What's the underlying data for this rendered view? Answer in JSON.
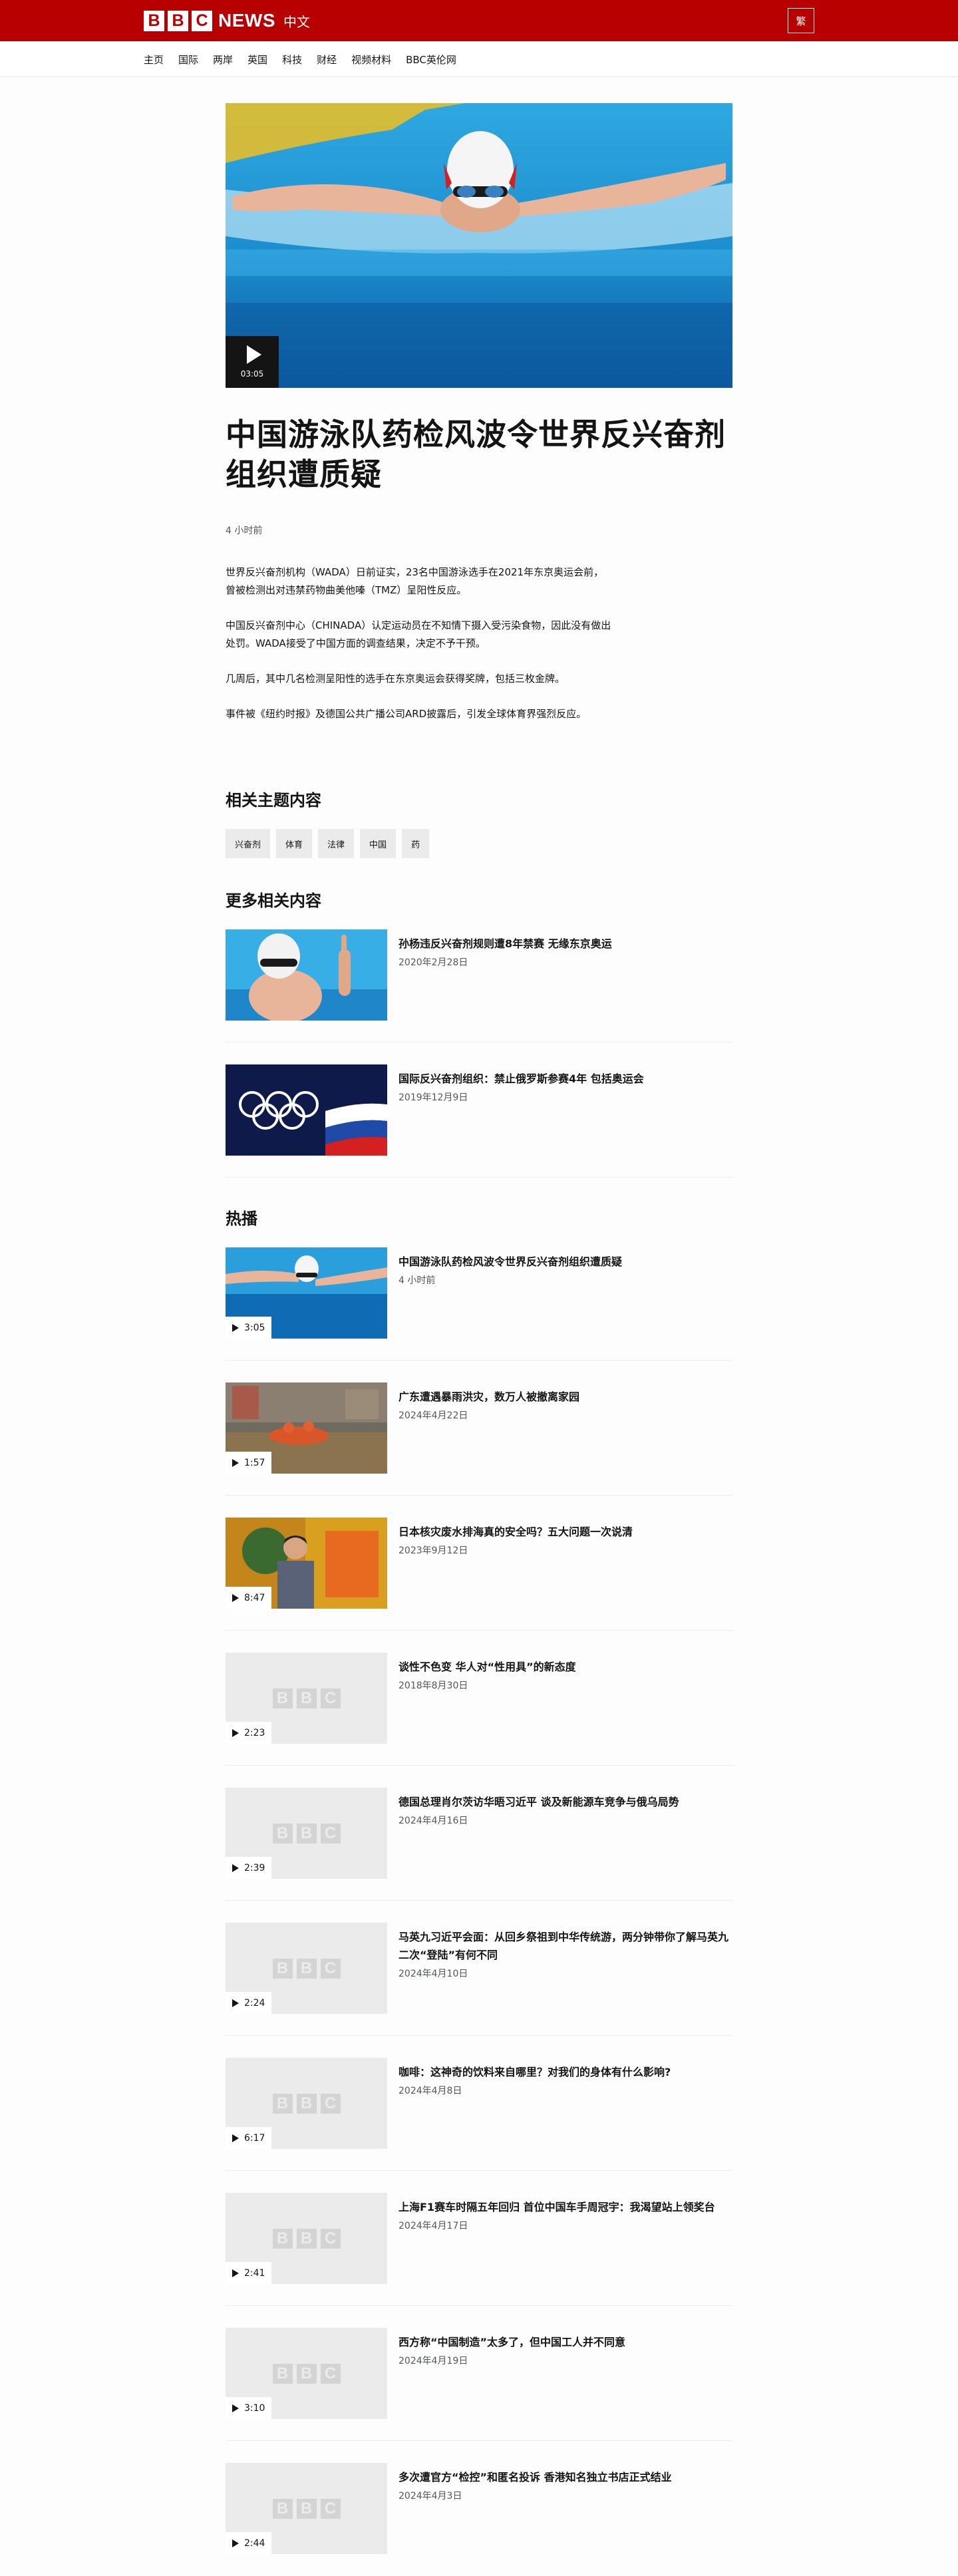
{
  "header": {
    "logo_letters": [
      "B",
      "B",
      "C"
    ],
    "logo_news": "NEWS",
    "logo_chinese": "中文",
    "trad_button": "繁"
  },
  "nav": {
    "items": [
      "主页",
      "国际",
      "两岸",
      "英国",
      "科技",
      "财经",
      "视频材料",
      "BBC英伦网"
    ]
  },
  "article": {
    "video_duration": "03:05",
    "headline": "中国游泳队药检风波令世界反兴奋剂组织遭质疑",
    "timestamp": "4 小时前",
    "paragraphs": [
      "世界反兴奋剂机构（WADA）日前证实，23名中国游泳选手在2021年东京奥运会前，曾被检测出对违禁药物曲美他嗪（TMZ）呈阳性反应。",
      "中国反兴奋剂中心（CHINADA）认定运动员在不知情下摄入受污染食物，因此没有做出处罚。WADA接受了中国方面的调查结果，决定不予干预。",
      "几周后，其中几名检测呈阳性的选手在东京奥运会获得奖牌，包括三枚金牌。",
      "事件被《纽约时报》及德国公共广播公司ARD披露后，引发全球体育界强烈反应。"
    ]
  },
  "related_topics": {
    "title": "相关主题内容",
    "tags": [
      "兴奋剂",
      "体育",
      "法律",
      "中国",
      "药"
    ]
  },
  "more": {
    "title": "更多相关内容",
    "items": [
      {
        "title": "孙杨违反兴奋剂规则遭8年禁赛 无缘东京奥运",
        "date": "2020年2月28日"
      },
      {
        "title": "国际反兴奋剂组织：禁止俄罗斯参赛4年 包括奥运会",
        "date": "2019年12月9日"
      }
    ]
  },
  "popular": {
    "title": "热播",
    "placeholder_letters": [
      "B",
      "B",
      "C"
    ],
    "items": [
      {
        "title": "中国游泳队药检风波令世界反兴奋剂组织遭质疑",
        "date": "4 小时前",
        "duration": "3:05"
      },
      {
        "title": "广东遭遇暴雨洪灾，数万人被撤离家园",
        "date": "2024年4月22日",
        "duration": "1:57"
      },
      {
        "title": "日本核灾废水排海真的安全吗？五大问题一次说清",
        "date": "2023年9月12日",
        "duration": "8:47"
      },
      {
        "title": "谈性不色变 华人对“性用具”的新态度",
        "date": "2018年8月30日",
        "duration": "2:23"
      },
      {
        "title": "德国总理肖尔茨访华晤习近平 谈及新能源车竞争与俄乌局势",
        "date": "2024年4月16日",
        "duration": "2:39"
      },
      {
        "title": "马英九习近平会面：从回乡祭祖到中华传统游，两分钟带你了解马英九二次“登陆”有何不同",
        "date": "2024年4月10日",
        "duration": "2:24"
      },
      {
        "title": "咖啡：这神奇的饮料来自哪里？对我们的身体有什么影响?",
        "date": "2024年4月8日",
        "duration": "6:17"
      },
      {
        "title": "上海F1赛车时隔五年回归 首位中国车手周冠宇：我渴望站上领奖台",
        "date": "2024年4月17日",
        "duration": "2:41"
      },
      {
        "title": "西方称“中国制造”太多了，但中国工人并不同意",
        "date": "2024年4月19日",
        "duration": "3:10"
      },
      {
        "title": "多次遭官方“检控”和匿名投诉 香港知名独立书店正式结业",
        "date": "2024年4月3日",
        "duration": "2:44"
      }
    ]
  }
}
